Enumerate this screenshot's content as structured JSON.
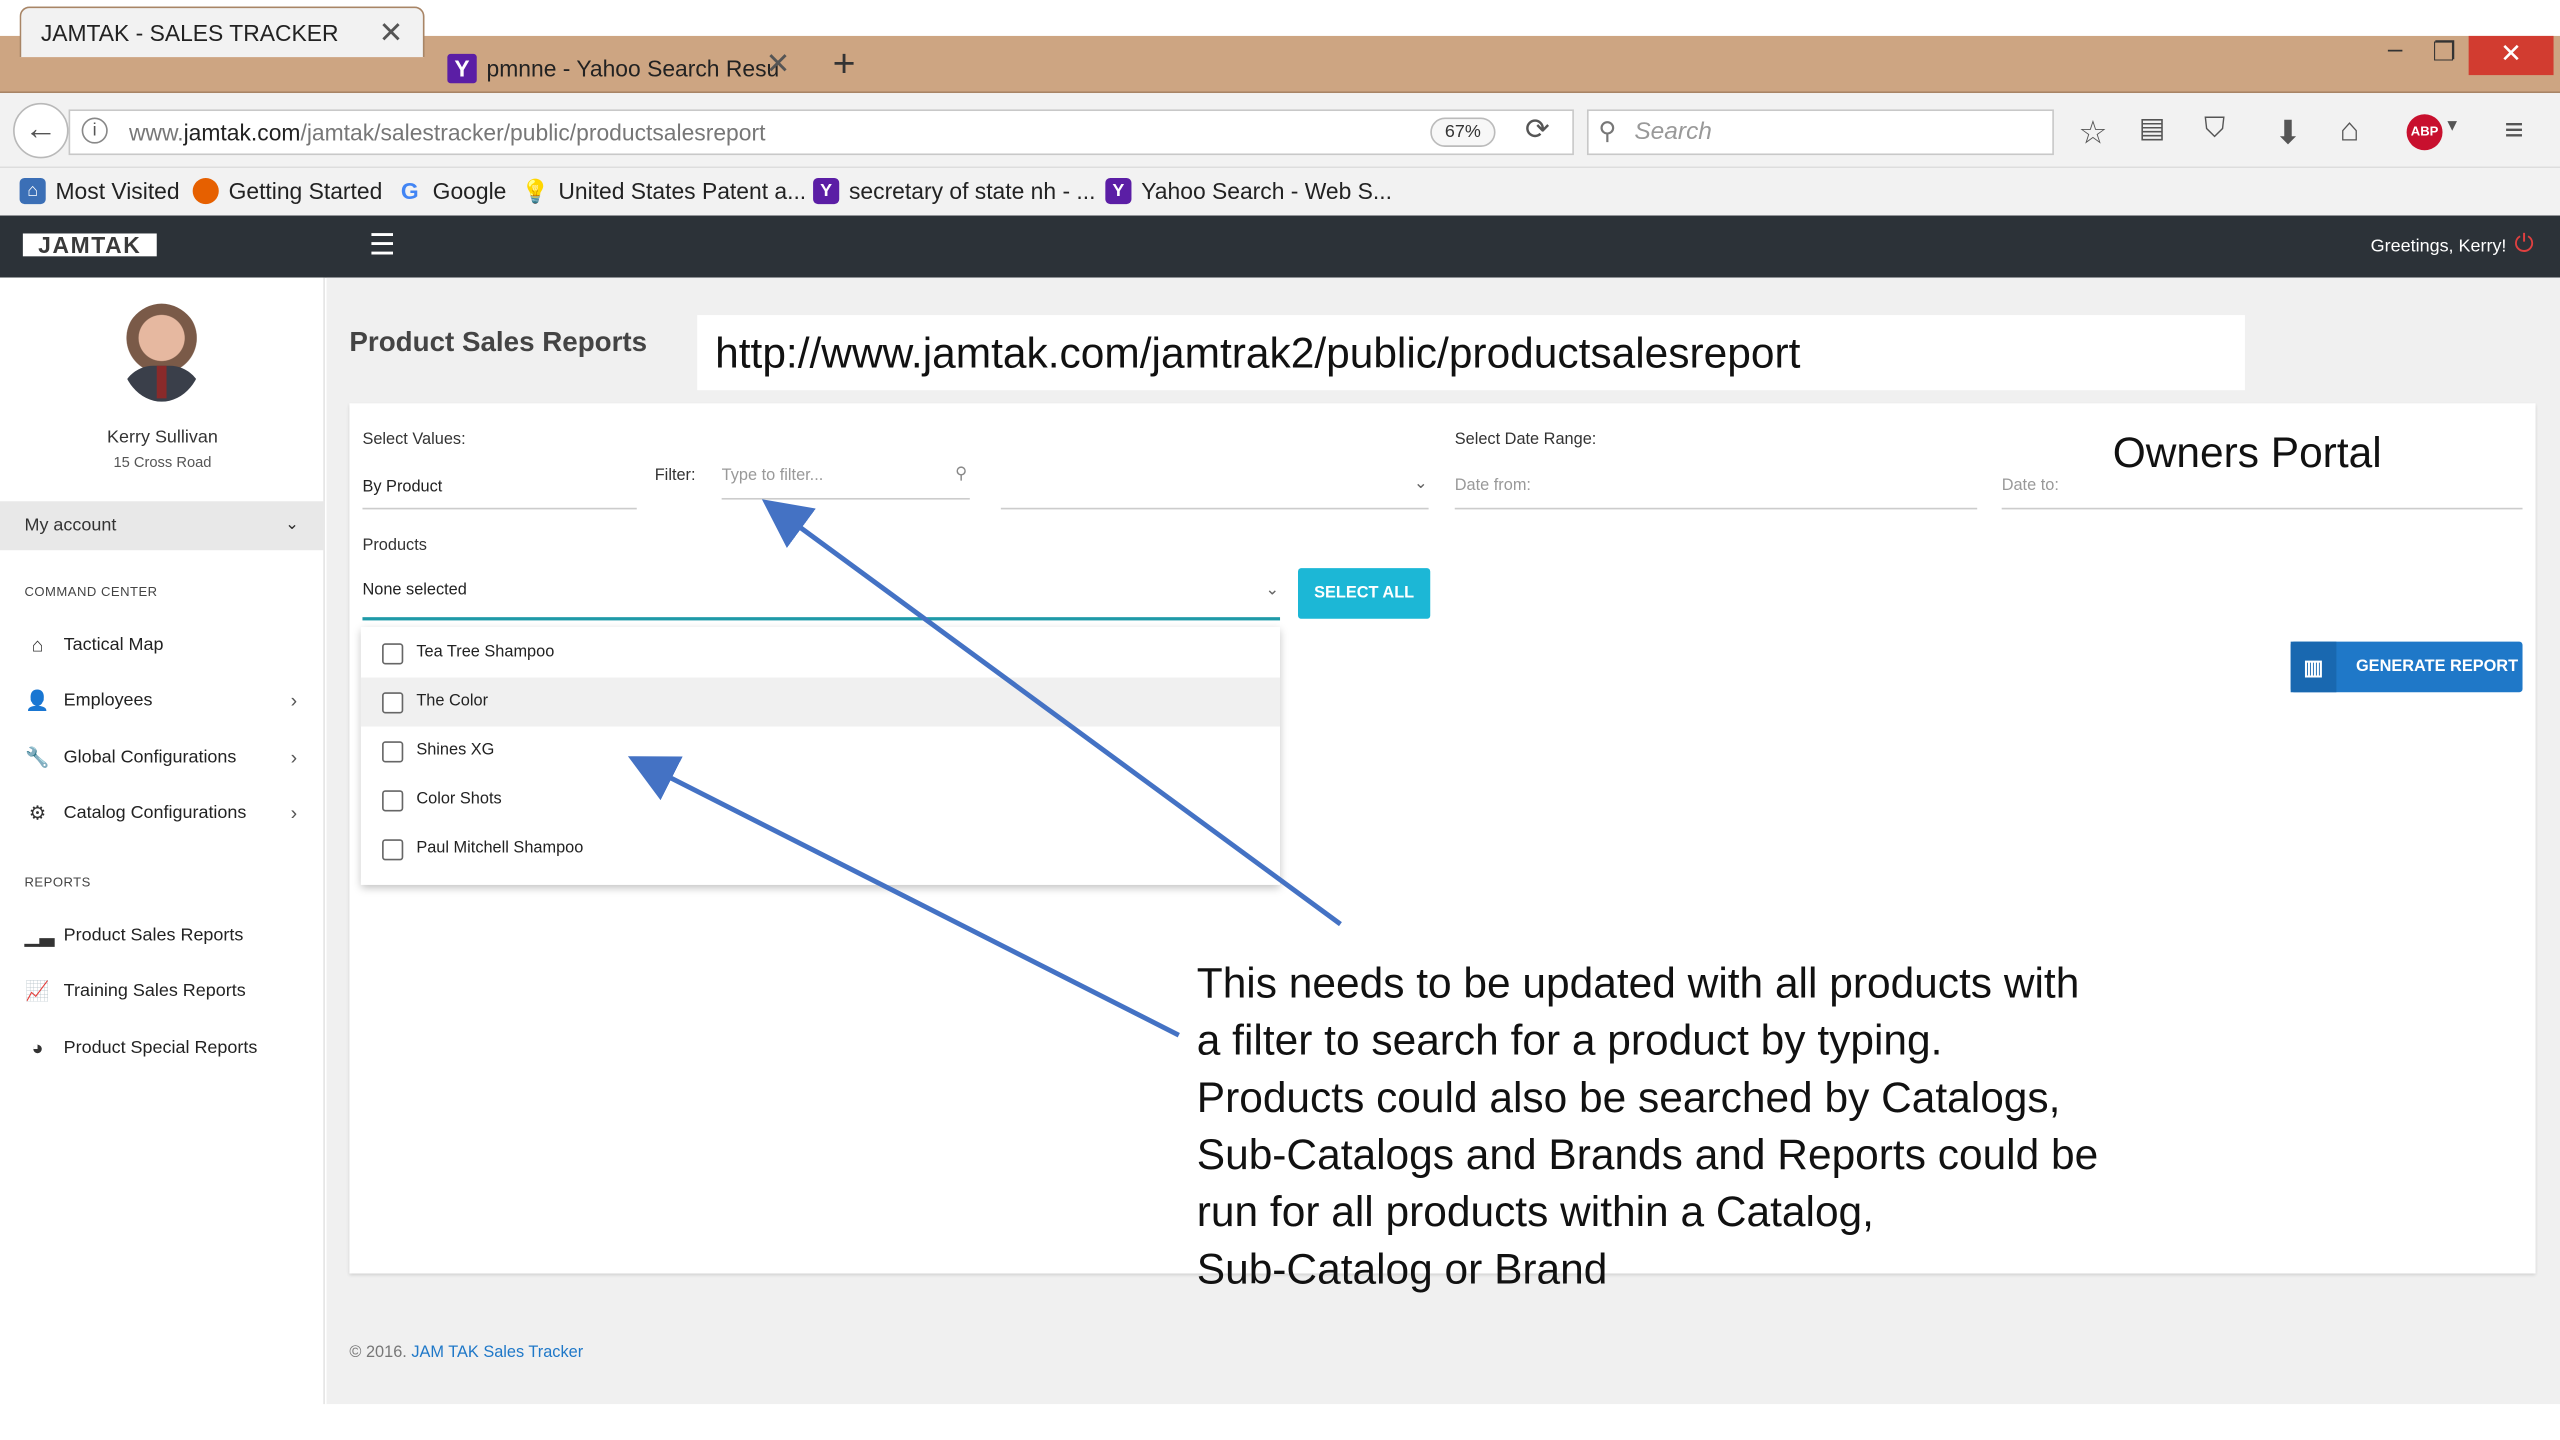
{
  "browser": {
    "tabs": [
      {
        "title": "JAMTAK - SALES TRACKER",
        "active": true
      },
      {
        "title": "pmnne - Yahoo Search Resu",
        "active": false
      }
    ],
    "url_prefix": "www.",
    "url_domain": "jamtak.com",
    "url_path": "/jamtak/salestracker/public/productsalesreport",
    "zoom": "67%",
    "search_placeholder": "Search",
    "bookmarks": [
      "Most Visited",
      "Getting Started",
      "Google",
      "United States Patent a...",
      "secretary of state nh - ...",
      "Yahoo Search - Web S..."
    ]
  },
  "app": {
    "logo": "JAMTAK",
    "greeting": "Greetings, Kerry!"
  },
  "sidebar": {
    "user_name": "Kerry Sullivan",
    "user_address": "15 Cross Road",
    "my_account": "My account",
    "section_command": "COMMAND CENTER",
    "command_items": [
      {
        "label": "Tactical Map",
        "icon": "home-icon"
      },
      {
        "label": "Employees",
        "icon": "users-icon"
      },
      {
        "label": "Global Configurations",
        "icon": "wrench-icon"
      },
      {
        "label": "Catalog Configurations",
        "icon": "gear-icon"
      }
    ],
    "section_reports": "REPORTS",
    "report_items": [
      {
        "label": "Product Sales Reports",
        "icon": "bar-chart-icon"
      },
      {
        "label": "Training Sales Reports",
        "icon": "line-chart-icon"
      },
      {
        "label": "Product Special Reports",
        "icon": "pie-chart-icon"
      }
    ]
  },
  "main": {
    "page_title": "Product Sales Reports",
    "url_annotation": "http://www.jamtak.com/jamtrak2/public/productsalesreport",
    "select_values_label": "Select Values:",
    "select_values_value": "By Product",
    "filter_label": "Filter:",
    "filter_placeholder": "Type to filter...",
    "date_range_label": "Select Date Range:",
    "date_from_placeholder": "Date from:",
    "date_to_placeholder": "Date to:",
    "products_label": "Products",
    "products_value": "None selected",
    "select_all": "SELECT ALL",
    "generate_report": "GENERATE REPORT",
    "owners_portal": "Owners Portal",
    "products": [
      "Tea Tree Shampoo",
      "The Color",
      "Shines XG",
      "Color Shots",
      "Paul Mitchell Shampoo"
    ],
    "annotation_lines": [
      "This needs to be updated with all products with",
      "a filter to search for a product by typing.",
      "Products could also be searched by Catalogs,",
      "Sub-Catalogs and Brands and Reports could be",
      "run for all products within a Catalog,",
      "Sub-Catalog or Brand"
    ]
  },
  "footer": {
    "copyright": "© 2016.",
    "link": "JAM TAK Sales Tracker"
  },
  "colors": {
    "app_header": "#2c3238",
    "accent_teal": "#1cb7d6",
    "accent_blue": "#1f78c8",
    "arrow": "#4472c4"
  }
}
